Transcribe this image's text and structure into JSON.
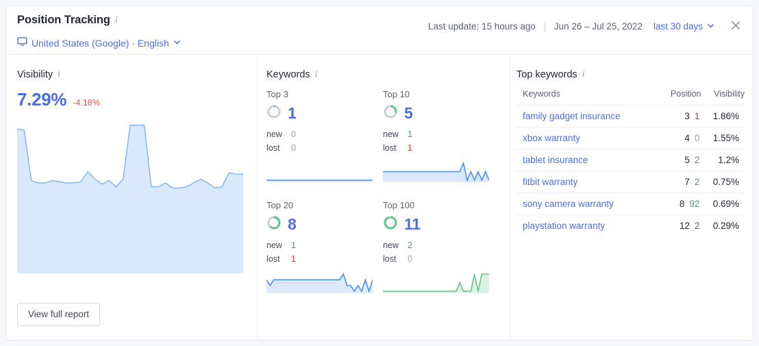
{
  "header": {
    "title": "Position Tracking",
    "info_icon": "info-icon",
    "locale": "United States (Google) · English",
    "locale_icon": "monitor-icon",
    "locale_chevron": "chevron-down-icon",
    "last_update": "Last update: 15 hours ago",
    "date_range": "Jun 26 – Jul 25, 2022",
    "period": "last 30 days",
    "period_chevron": "chevron-down-icon",
    "close_icon": "close-icon"
  },
  "visibility": {
    "label": "Visibility",
    "info_icon": "info-icon",
    "value": "7.29%",
    "delta": "-4.18%"
  },
  "keywords": {
    "label": "Keywords",
    "info_icon": "info-icon",
    "groups": [
      {
        "label": "Top 3",
        "count": "1",
        "new_label": "new",
        "new": "0",
        "new_state": "zero",
        "lost_label": "lost",
        "lost": "0",
        "lost_state": "zero",
        "donut_pct": 4,
        "spark_color": "#4b8ff0"
      },
      {
        "label": "Top 10",
        "count": "5",
        "new_label": "new",
        "new": "1",
        "new_state": "new",
        "lost_label": "lost",
        "lost": "1",
        "lost_state": "lost",
        "donut_pct": 28,
        "spark_color": "#4b8ff0"
      },
      {
        "label": "Top 20",
        "count": "8",
        "new_label": "new",
        "new": "1",
        "new_state": "new",
        "lost_label": "lost",
        "lost": "1",
        "lost_state": "lost",
        "donut_pct": 62,
        "spark_color": "#4b8ff0"
      },
      {
        "label": "Top 100",
        "count": "11",
        "new_label": "new",
        "new": "2",
        "new_state": "new",
        "lost_label": "lost",
        "lost": "0",
        "lost_state": "zero",
        "donut_pct": 96,
        "spark_color": "#63c38a"
      }
    ]
  },
  "top_keywords": {
    "label": "Top keywords",
    "info_icon": "info-icon",
    "columns": [
      "Keywords",
      "Position",
      "Visibility"
    ],
    "rows": [
      {
        "keyword": "family gadget insurance",
        "position": "3",
        "change": "1",
        "change_state": "down",
        "visibility": "1.86%"
      },
      {
        "keyword": "xbox warranty",
        "position": "4",
        "change": "0",
        "change_state": "flat",
        "visibility": "1.55%"
      },
      {
        "keyword": "tablet insurance",
        "position": "5",
        "change": "2",
        "change_state": "up",
        "visibility": "1.2%"
      },
      {
        "keyword": "fitbit warranty",
        "position": "7",
        "change": "2",
        "change_state": "up",
        "visibility": "0.75%"
      },
      {
        "keyword": "sony camera warranty",
        "position": "8",
        "change": "92",
        "change_state": "up",
        "visibility": "0.69%"
      },
      {
        "keyword": "playstation warranty",
        "position": "12",
        "change": "2",
        "change_state": "down",
        "visibility": "0.29%"
      }
    ]
  },
  "footer": {
    "report_button": "View full report"
  },
  "colors": {
    "accent_blue": "#4b6ee8",
    "chart_blue": "#7eb3f5",
    "chart_blue_fill": "#d9e8fb",
    "green": "#63c38a",
    "red": "#e5544b",
    "gray": "#9aa0b0"
  },
  "chart_data": {
    "type": "area",
    "title": "Visibility",
    "xlabel": "",
    "ylabel": "Visibility %",
    "ylim": [
      0,
      12
    ],
    "grid": false,
    "legend": "none",
    "series": [
      {
        "name": "Visibility",
        "values": [
          11.5,
          11.4,
          7.4,
          7.2,
          7.2,
          7.4,
          7.3,
          7.2,
          7.2,
          7.3,
          8.1,
          7.5,
          7.1,
          7.4,
          6.9,
          7.5,
          11.8,
          11.8,
          11.8,
          6.9,
          6.9,
          7.2,
          6.8,
          6.8,
          6.9,
          7.2,
          7.5,
          7.2,
          6.8,
          6.9,
          8.0,
          7.9,
          7.9
        ]
      }
    ],
    "sparklines": [
      {
        "name": "Top 3",
        "color": "#4b8ff0",
        "values": [
          1,
          1,
          1,
          1,
          1,
          1,
          1,
          1,
          1,
          1,
          1,
          1,
          1,
          1,
          1,
          1,
          1,
          1,
          1,
          1,
          1,
          1,
          1,
          1,
          1,
          1,
          1,
          1,
          1,
          1
        ]
      },
      {
        "name": "Top 10",
        "color": "#4b8ff0",
        "values": [
          5,
          5,
          5,
          5,
          5,
          5,
          5,
          5,
          5,
          5,
          5,
          5,
          5,
          5,
          5,
          5,
          5,
          5,
          5,
          5,
          5,
          5,
          6,
          4,
          5,
          4,
          5,
          4,
          5,
          4
        ]
      },
      {
        "name": "Top 20",
        "color": "#4b8ff0",
        "values": [
          8,
          7,
          8,
          8,
          8,
          8,
          8,
          8,
          8,
          8,
          8,
          8,
          8,
          8,
          8,
          8,
          8,
          8,
          8,
          8,
          8,
          9,
          7,
          7,
          6,
          7,
          6,
          8,
          6,
          8
        ]
      },
      {
        "name": "Top 100",
        "color": "#63c38a",
        "values": [
          11,
          11,
          11,
          11,
          11,
          11,
          11,
          11,
          11,
          11,
          11,
          11,
          11,
          11,
          11,
          11,
          11,
          11,
          11,
          11,
          11,
          12,
          11,
          11,
          11,
          13,
          11,
          13,
          13,
          13
        ]
      }
    ]
  }
}
